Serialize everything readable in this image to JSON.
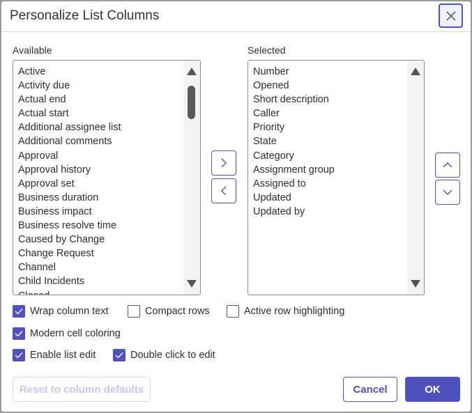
{
  "dialog": {
    "title": "Personalize List Columns",
    "close_icon": "close-icon"
  },
  "available": {
    "label": "Available",
    "items": [
      "Active",
      "Activity due",
      "Actual end",
      "Actual start",
      "Additional assignee list",
      "Additional comments",
      "Approval",
      "Approval history",
      "Approval set",
      "Business duration",
      "Business impact",
      "Business resolve time",
      "Caused by Change",
      "Change Request",
      "Channel",
      "Child Incidents",
      "Closed"
    ]
  },
  "selected": {
    "label": "Selected",
    "items": [
      "Number",
      "Opened",
      "Short description",
      "Caller",
      "Priority",
      "State",
      "Category",
      "Assignment group",
      "Assigned to",
      "Updated",
      "Updated by"
    ]
  },
  "options": [
    {
      "label": "Wrap column text",
      "checked": true
    },
    {
      "label": "Compact rows",
      "checked": false
    },
    {
      "label": "Active row highlighting",
      "checked": false
    },
    {
      "label": "Modern cell coloring",
      "checked": true
    },
    {
      "label": "Enable list edit",
      "checked": true
    },
    {
      "label": "Double click to edit",
      "checked": true
    }
  ],
  "buttons": {
    "reset": "Reset to column defaults",
    "cancel": "Cancel",
    "ok": "OK"
  },
  "colors": {
    "accent": "#4f52bd",
    "disabled_text": "#c5c7ec"
  }
}
